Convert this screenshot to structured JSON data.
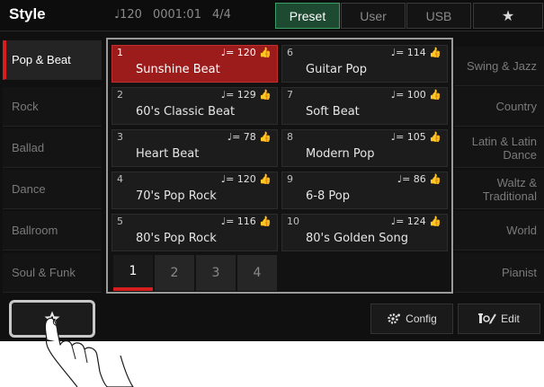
{
  "header": {
    "title": "Style",
    "tempo": "♩120",
    "position": "0001:01",
    "time_signature": "4/4",
    "tabs": [
      {
        "label": "Preset"
      },
      {
        "label": "User"
      },
      {
        "label": "USB"
      },
      {
        "label": "★"
      }
    ]
  },
  "categories_left": [
    {
      "label": "Pop & Beat"
    },
    {
      "label": "Rock"
    },
    {
      "label": "Ballad"
    },
    {
      "label": "Dance"
    },
    {
      "label": "Ballroom"
    },
    {
      "label": "Soul & Funk"
    }
  ],
  "categories_right": [
    {
      "label": "Swing & Jazz"
    },
    {
      "label": "Country"
    },
    {
      "label": "Latin & Latin Dance"
    },
    {
      "label": "Waltz & Traditional"
    },
    {
      "label": "World"
    },
    {
      "label": "Pianist"
    }
  ],
  "styles": [
    {
      "number": "1",
      "tempo": "♩= 120 👍",
      "name": "Sunshine Beat"
    },
    {
      "number": "2",
      "tempo": "♩= 129 👍",
      "name": "60's Classic Beat"
    },
    {
      "number": "3",
      "tempo": "♩= 78 👍",
      "name": "Heart Beat"
    },
    {
      "number": "4",
      "tempo": "♩= 120 👍",
      "name": "70's Pop Rock"
    },
    {
      "number": "5",
      "tempo": "♩= 116 👍",
      "name": "80's Pop Rock"
    },
    {
      "number": "6",
      "tempo": "♩= 114 👍",
      "name": "Guitar Pop"
    },
    {
      "number": "7",
      "tempo": "♩= 100 👍",
      "name": "Soft Beat"
    },
    {
      "number": "8",
      "tempo": "♩= 105 👍",
      "name": "Modern Pop"
    },
    {
      "number": "9",
      "tempo": "♩= 86 👍",
      "name": "6-8 Pop"
    },
    {
      "number": "10",
      "tempo": "♩= 124 👍",
      "name": "80's Golden Song"
    }
  ],
  "pages": [
    "1",
    "2",
    "3",
    "4"
  ],
  "bottom": {
    "favorite_icon": "star-plus-icon",
    "config_label": "Config",
    "edit_label": "Edit"
  },
  "colors": {
    "accent_red": "#d61e1e",
    "selected_cell": "#9c1c1c",
    "active_tab": "#1e4a32"
  }
}
